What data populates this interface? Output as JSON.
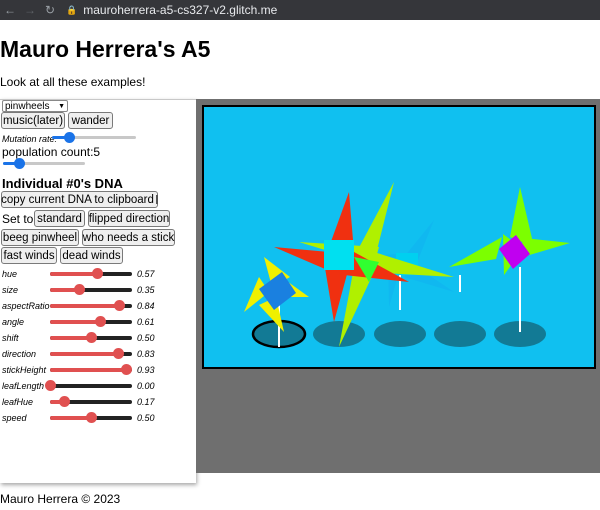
{
  "browser": {
    "url": "mauroherrera-a5-cs327-v2.glitch.me"
  },
  "page": {
    "title": "Mauro Herrera's A5",
    "subtitle": "Look at all these examples!",
    "footer": "Mauro Herrera © 2023"
  },
  "controls": {
    "preset_selected": "pinwheels",
    "music_label": "music(later)",
    "wander_label": "wander",
    "mutation_label": "Mutation rate:",
    "mutation_level": 0.2,
    "population_label": "population count:5",
    "population_level": 0.2
  },
  "dna": {
    "heading": "Individual #0's DNA",
    "copy_label": "copy current DNA to clipboard",
    "set_to_label": "Set to:",
    "presets": [
      "standard",
      "flipped direction",
      "beeg pinwheel",
      "who needs a stick",
      "fast winds",
      "dead winds"
    ],
    "genes": [
      {
        "name": "hue",
        "value": "0.57",
        "level": 0.57
      },
      {
        "name": "size",
        "value": "0.35",
        "level": 0.35
      },
      {
        "name": "aspectRatio",
        "value": "0.84",
        "level": 0.84
      },
      {
        "name": "angle",
        "value": "0.61",
        "level": 0.61
      },
      {
        "name": "shift",
        "value": "0.50",
        "level": 0.5
      },
      {
        "name": "direction",
        "value": "0.83",
        "level": 0.83
      },
      {
        "name": "stickHeight",
        "value": "0.93",
        "level": 0.93
      },
      {
        "name": "leafLength",
        "value": "0.00",
        "level": 0.0
      },
      {
        "name": "leafHue",
        "value": "0.17",
        "level": 0.17
      },
      {
        "name": "speed",
        "value": "0.50",
        "level": 0.5
      }
    ]
  },
  "colors": {
    "canvas_bg": "#10c0f0",
    "stage_bg": "#6f6f6f",
    "slider_blue": "#1a73e8",
    "gene_red": "#e05050"
  },
  "icons": {
    "back": "arrow-left-icon",
    "forward": "arrow-right-icon",
    "reload": "reload-icon",
    "lock": "lock-icon",
    "clipboard": "clipboard-icon",
    "dropdown": "chevron-down-icon"
  }
}
